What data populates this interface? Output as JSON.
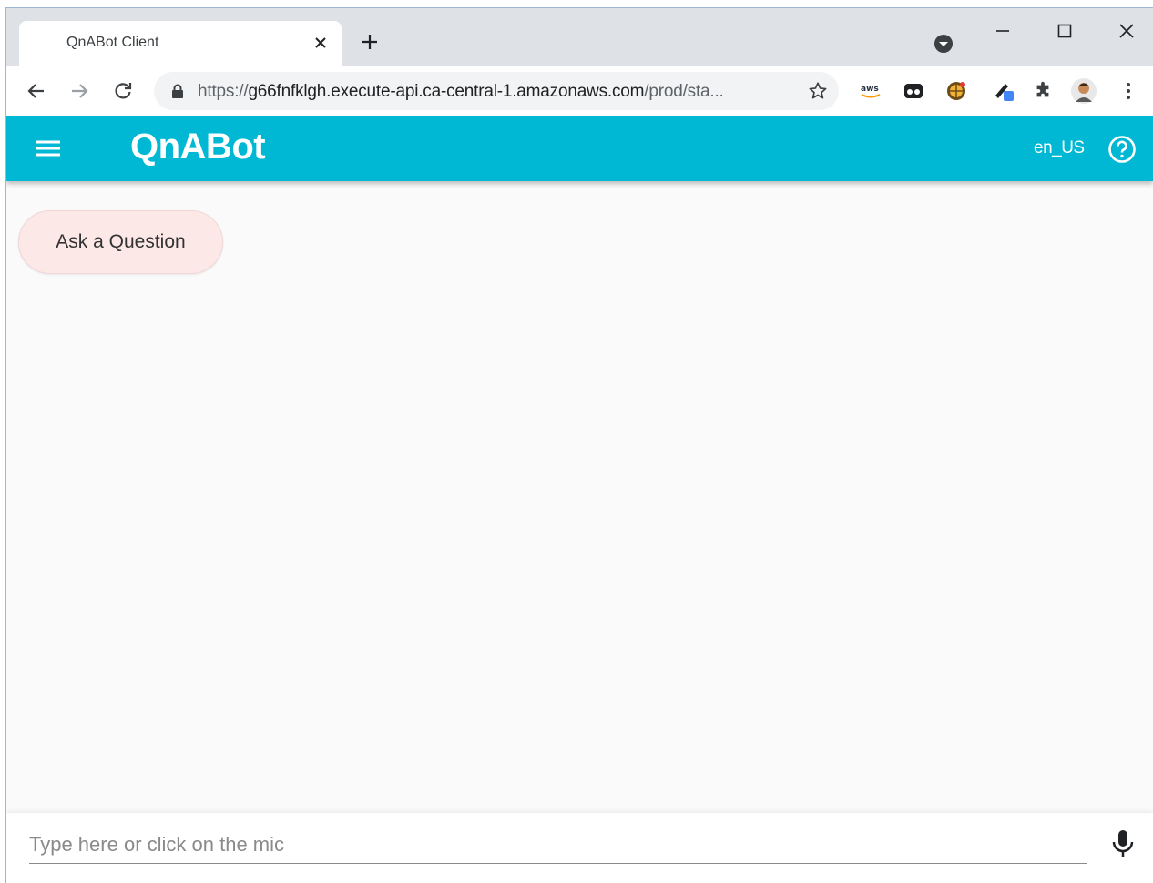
{
  "browser": {
    "tab_title": "QnABot Client",
    "url_scheme": "https://",
    "url_host": "g66fnfklgh.execute-api.ca-central-1.amazonaws.com",
    "url_path": "/prod/sta..."
  },
  "app": {
    "title": "QnABot",
    "locale": "en_US",
    "accent_color": "#00b8d4"
  },
  "content": {
    "suggestion_chip": "Ask a Question"
  },
  "input": {
    "placeholder": "Type here or click on the mic"
  },
  "icons": [
    "menu-icon",
    "help-icon",
    "mic-icon",
    "lock-icon",
    "star-icon",
    "close-icon",
    "plus-icon"
  ]
}
